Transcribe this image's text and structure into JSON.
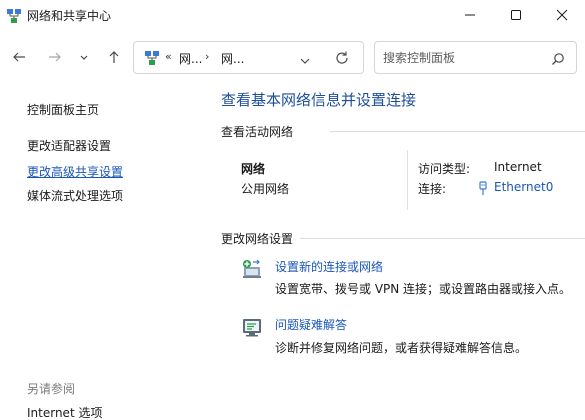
{
  "window": {
    "title": "网络和共享中心"
  },
  "navigation": {
    "breadcrumb": {
      "overflow": "«",
      "segment1": "网...",
      "separator": "›",
      "segment2": "网..."
    },
    "search": {
      "placeholder": "搜索控制面板"
    }
  },
  "sidebar": {
    "items": [
      {
        "label": "控制面板主页"
      },
      {
        "label": "更改适配器设置"
      },
      {
        "label": "更改高级共享设置"
      },
      {
        "label": "媒体流式处理选项"
      }
    ],
    "see_also": {
      "heading": "另请参阅",
      "items": [
        {
          "label": "Internet 选项"
        }
      ]
    }
  },
  "main": {
    "title": "查看基本网络信息并设置连接",
    "active_networks": {
      "heading": "查看活动网络",
      "network_name": "网络",
      "network_type": "公用网络",
      "access_type_label": "访问类型:",
      "access_type_value": "Internet",
      "connection_label": "连接:",
      "connection_value": "Ethernet0"
    },
    "change_settings": {
      "heading": "更改网络设置",
      "tasks": [
        {
          "icon": "network-setup-icon",
          "link": "设置新的连接或网络",
          "description": "设置宽带、拨号或 VPN 连接；或设置路由器或接入点。"
        },
        {
          "icon": "troubleshoot-icon",
          "link": "问题疑难解答",
          "description": "诊断并修复网络问题，或者获得疑难解答信息。"
        }
      ]
    }
  },
  "colors": {
    "link": "#1a56b8",
    "title": "#1e4e9a",
    "muted": "#7a7a7a",
    "divider": "#dcdcdc"
  }
}
